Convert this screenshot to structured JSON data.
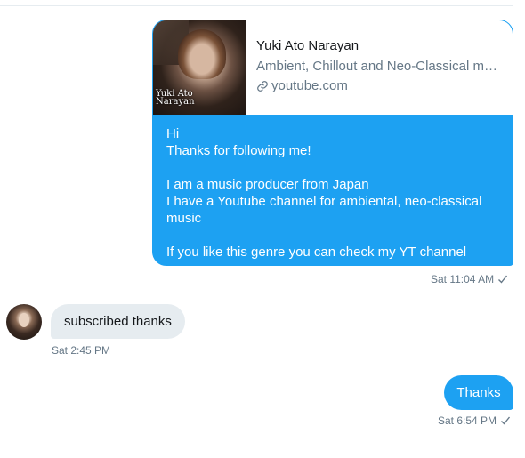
{
  "link_preview": {
    "title": "Yuki Ato Narayan",
    "description": "Ambient, Chillout and Neo-Classical mu…",
    "domain": "youtube.com",
    "thumbnail_logo_line1": "Yuki Ato",
    "thumbnail_logo_line2": "Narayan"
  },
  "messages": {
    "first": {
      "lines": [
        "Hi",
        "Thanks for following me!",
        "",
        "I am a music producer from Japan",
        "I have a Youtube channel for ambiental, neo-classical music",
        "",
        "If you like this genre you can check  my  YT channel"
      ],
      "timestamp": "Sat 11:04 AM"
    },
    "reply": {
      "text": "subscribed thanks",
      "timestamp": "Sat 2:45 PM"
    },
    "last": {
      "text": "Thanks",
      "timestamp": "Sat 6:54 PM"
    }
  },
  "colors": {
    "accent": "#1da1f2",
    "incoming_bubble": "#e6ecf0",
    "meta_text": "#657786"
  }
}
